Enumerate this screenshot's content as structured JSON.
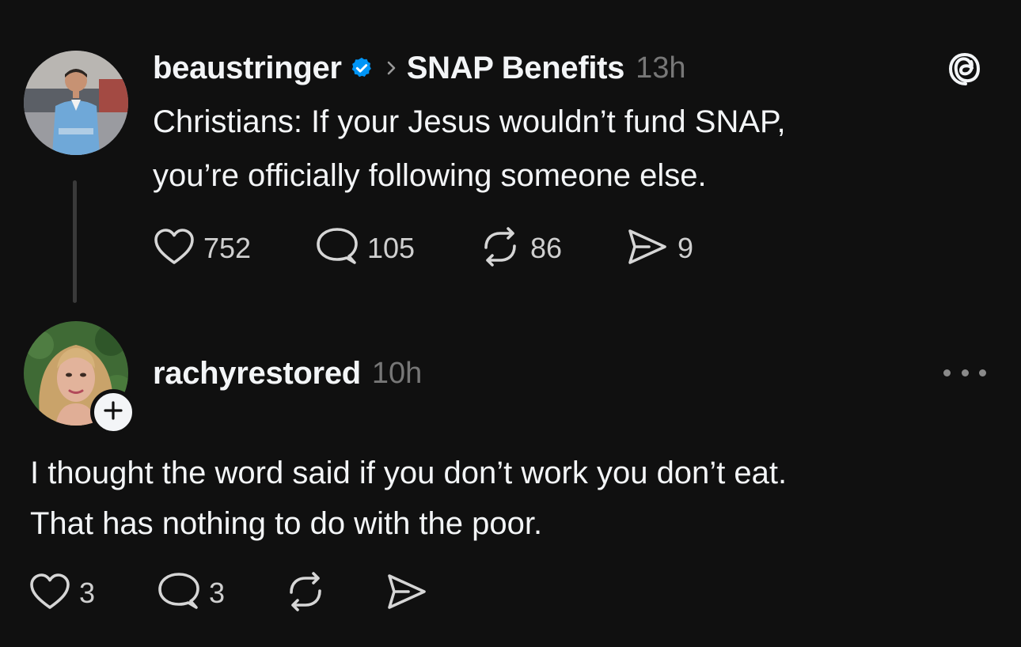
{
  "post": {
    "author": "beaustringer",
    "topic": "SNAP Benefits",
    "time": "13h",
    "text_line1": "Christians: If your Jesus wouldn’t fund SNAP,",
    "text_line2": "you’re officially following someone else.",
    "likes": "752",
    "replies": "105",
    "reposts": "86",
    "shares": "9"
  },
  "reply": {
    "author": "rachyrestored",
    "time": "10h",
    "text_line1": "I thought the word said if you don’t work you don’t eat.",
    "text_line2": "That has nothing to do with the poor.",
    "likes": "3",
    "replies": "3"
  },
  "icons": {
    "app_logo": "threads-logo-icon",
    "verified": "verified-badge-icon",
    "like": "heart-icon",
    "reply": "comment-bubble-icon",
    "repost": "repost-icon",
    "share": "send-icon",
    "more": "more-options-icon",
    "follow": "plus-icon"
  },
  "colors": {
    "background": "#101010",
    "text": "#f3f5f7",
    "muted": "#777777",
    "verified": "#0095f6"
  }
}
